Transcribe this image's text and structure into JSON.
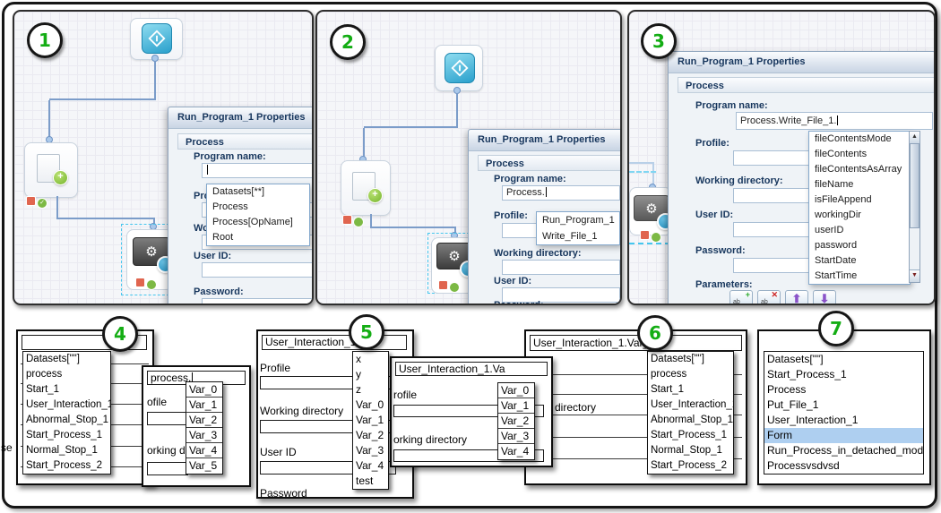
{
  "frame_badges": {
    "p1": "1",
    "p2": "2",
    "p3": "3",
    "p4": "4",
    "p5": "5",
    "p6": "6",
    "p7": "7"
  },
  "dialog": {
    "title": "Run_Program_1 Properties",
    "section": "Process",
    "labels": {
      "program_name": "Program name:",
      "profile": "Profile:",
      "working_directory": "Working directory:",
      "user_id": "User ID:",
      "password": "Password:",
      "parameters": "Parameters:"
    }
  },
  "panel1": {
    "program_name_value": "",
    "autocomplete": [
      "Datasets[**]",
      "Process",
      "Process[OpName]",
      "Root"
    ]
  },
  "panel2": {
    "program_name_value": "Process.",
    "autocomplete": [
      "Run_Program_1",
      "Write_File_1"
    ]
  },
  "panel3": {
    "program_name_value": "Process.Write_File_1.",
    "autocomplete": [
      "fileContentsMode",
      "fileContents",
      "fileContentsAsArray",
      "fileName",
      "isFileAppend",
      "workingDir",
      "userID",
      "password",
      "StartDate",
      "StartTime"
    ]
  },
  "panel4": {
    "edge_fragment": "se",
    "window_a": {
      "input_value": "",
      "list": [
        "Datasets[\"\"]",
        "process",
        "Start_1",
        "User_Interaction_1",
        "Abnormal_Stop_1",
        "Start_Process_1",
        "Normal_Stop_1",
        "Start_Process_2"
      ]
    },
    "window_b": {
      "input_value": "process.",
      "labels": [
        "ofile",
        "orking dire"
      ],
      "list": [
        "Var_0",
        "Var_1",
        "Var_2",
        "Var_3",
        "Var_4",
        "Var_5"
      ]
    }
  },
  "panel5": {
    "window_a": {
      "input_value": "User_Interaction_1.",
      "labels": [
        "Profile",
        "Working directory",
        "User ID",
        "Password"
      ],
      "list": [
        "x",
        "y",
        "z",
        "Var_0",
        "Var_1",
        "Var_2",
        "Var_3",
        "Var_4",
        "test"
      ]
    },
    "window_b": {
      "input_value": "User_Interaction_1.Va",
      "labels": [
        "rofile",
        "orking directory"
      ],
      "list": [
        "Var_0",
        "Var_1",
        "Var_2",
        "Var_3",
        "Var_4"
      ]
    }
  },
  "panel6": {
    "window": {
      "input_value": "User_Interaction_1.Var_1+",
      "labels": [
        "directory"
      ],
      "list": [
        "Datasets[\"\"]",
        "process",
        "Start_1",
        "User_Interaction_1",
        "Abnormal_Stop_1",
        "Start_Process_1",
        "Normal_Stop_1",
        "Start_Process_2"
      ]
    }
  },
  "panel7": {
    "window": {
      "list": [
        "Datasets[\"\"]",
        "Start_Process_1",
        "Process",
        "Put_File_1",
        "User_Interaction_1",
        "Form",
        "Run_Process_in_detached_mode_1",
        "Processvsdvsd"
      ],
      "highlighted_item": "Form",
      "highlighted_index": 5
    }
  },
  "icons": {
    "gear": "⚙",
    "plus": "+",
    "check": "✓",
    "close": "✕",
    "field_ab": "ab",
    "arrow_up": "⬆",
    "arrow_down": "⬇",
    "scroll_up": "▲",
    "scroll_down": "▼"
  },
  "colors": {
    "node_blue": "#2aa6d0",
    "connector_blue": "#7b9cc9",
    "selection_cyan": "#45c6ee",
    "badge_green": "#14ad14",
    "green_plus": "#8dc63f",
    "red_badge": "#e0654f",
    "highlight_row": "#aecff0",
    "dialog_text": "#17365d"
  }
}
